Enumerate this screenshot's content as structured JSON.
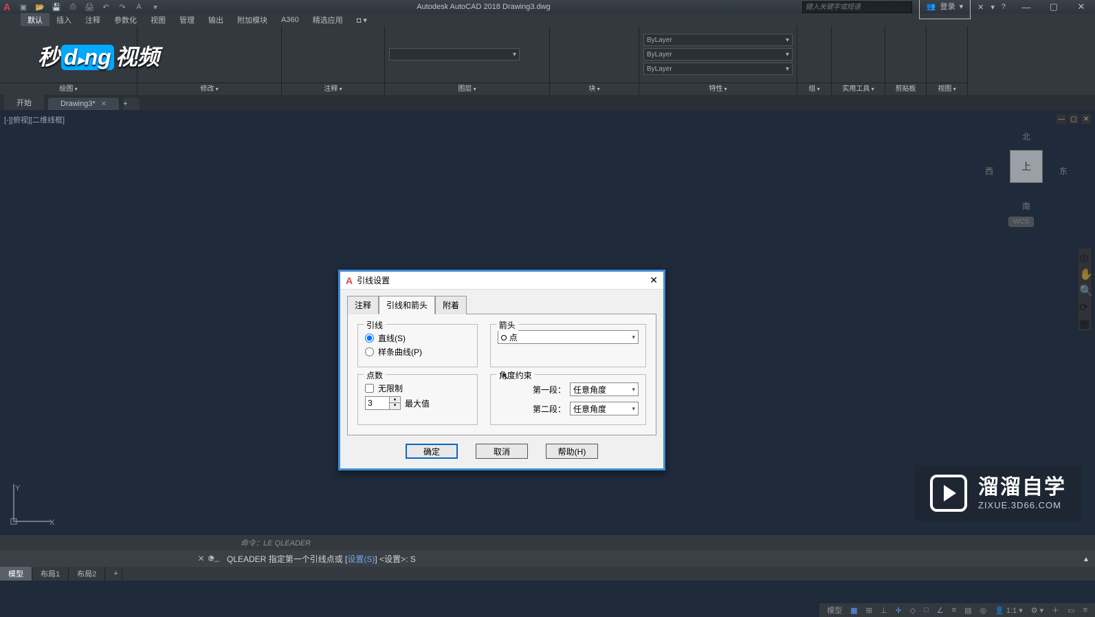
{
  "app": {
    "title": "Autodesk AutoCAD 2018   Drawing3.dwg",
    "search_placeholder": "键入关键字或短语",
    "login": "登录"
  },
  "menus": [
    "默认",
    "插入",
    "注释",
    "参数化",
    "视图",
    "管理",
    "输出",
    "附加模块",
    "A360",
    "精选应用"
  ],
  "panels": {
    "draw": "绘图",
    "modify": "修改",
    "annotate": "注释",
    "layers": "图层",
    "block": "块",
    "props": "特性",
    "group": "组",
    "utils": "实用工具",
    "clipboard": "剪贴板",
    "view": "视图"
  },
  "layer_combo": "",
  "props_combo": [
    "ByLayer",
    "ByLayer",
    "ByLayer"
  ],
  "tabs": {
    "start": "开始",
    "doc": "Drawing3*"
  },
  "viewport_label": "[-][俯视][二维线框]",
  "viewcube": {
    "n": "北",
    "s": "南",
    "e": "东",
    "w": "西",
    "face": "上",
    "wcs": "WCS"
  },
  "ucs": {
    "x": "X",
    "y": "Y"
  },
  "dialog": {
    "title": "引线设置",
    "tabs": [
      "注释",
      "引线和箭头",
      "附着"
    ],
    "active_tab": 1,
    "leader_group": "引线",
    "leader_straight": "直线(S)",
    "leader_spline": "样条曲线(P)",
    "arrow_group": "箭头",
    "arrow_value": "点",
    "points_group": "点数",
    "points_unlimited": "无限制",
    "points_value": "3",
    "points_max": "最大值",
    "angle_group": "角度约束",
    "seg1_label": "第一段：",
    "seg1_value": "任意角度",
    "seg2_label": "第二段：",
    "seg2_value": "任意角度",
    "ok": "确定",
    "cancel": "取消",
    "help": "帮助(H)"
  },
  "cmd_history": "命令：LE  QLEADER",
  "cmd": {
    "name": "QLEADER",
    "prompt_pre": "指定第一个引线点或  [",
    "opt": "设置(S)",
    "prompt_post": "] <设置>:  S"
  },
  "layout_tabs": [
    "模型",
    "布局1",
    "布局2"
  ],
  "status_model": "模型",
  "brand": {
    "big": "溜溜自学",
    "small": "ZIXUE.3D66.COM"
  },
  "top_watermark": "秒dōng视频"
}
